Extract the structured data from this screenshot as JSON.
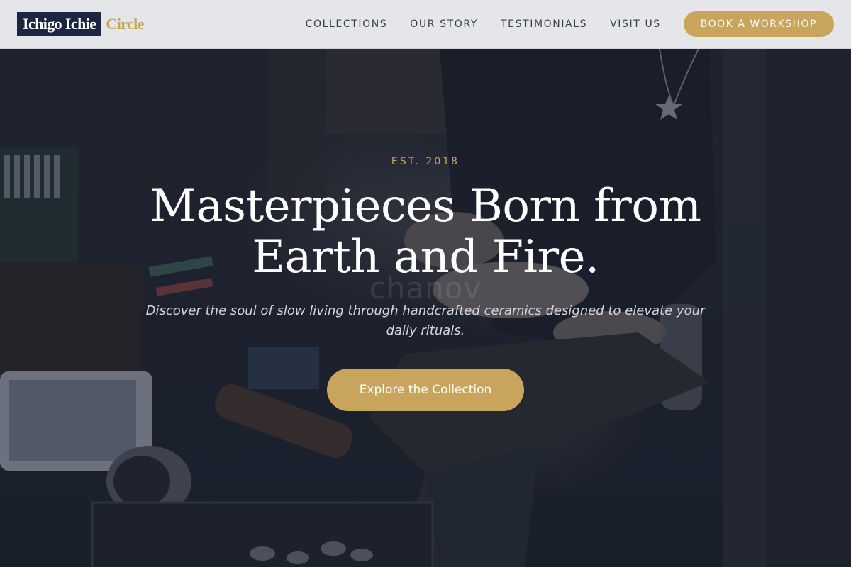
{
  "brand": {
    "name_primary": "Ichigo Ichie",
    "name_secondary": "Circle"
  },
  "nav": {
    "links": [
      "COLLECTIONS",
      "OUR STORY",
      "TESTIMONIALS",
      "VISIT US"
    ],
    "cta_label": "BOOK A WORKSHOP"
  },
  "hero": {
    "eyebrow": "EST. 2018",
    "headline": "Masterpieces Born from Earth and Fire.",
    "subhead": "Discover the soul of slow living through handcrafted ceramics designed to elevate your daily rituals.",
    "cta_label": "Explore the Collection",
    "watermark": "chanov"
  },
  "colors": {
    "accent_gold": "#c8a45c",
    "brand_navy": "#1c2640",
    "navbar_bg": "#e4e6e9",
    "overlay": "#161e30"
  }
}
